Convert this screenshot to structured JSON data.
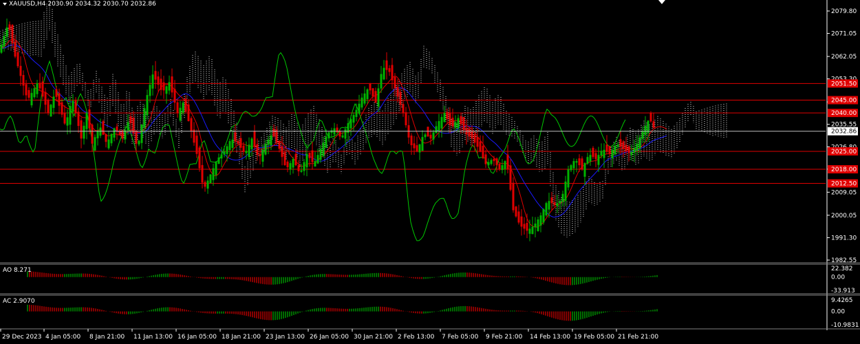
{
  "header": {
    "symbol_line": "XAUUSD,H4  2030.90 2034.32 2030.70 2032.86"
  },
  "colors": {
    "bull": "#00b400",
    "bear": "#e00000",
    "level_line": "#e00000",
    "ma_blue": "#1a1aff",
    "ma_red": "#e00000",
    "chikou": "#00c800",
    "cloud": "#ffffff",
    "axis": "#ffffff"
  },
  "price_axis": {
    "ticks": [
      "2079.80",
      "2071.05",
      "2062.05",
      "2053.30",
      "2044.30",
      "2035.55",
      "2026.80",
      "2018.05",
      "2009.05",
      "2000.05",
      "1991.30",
      "1982.55"
    ],
    "tick_values": [
      2079.8,
      2071.05,
      2062.05,
      2053.3,
      2044.3,
      2035.55,
      2026.8,
      2018.05,
      2009.05,
      2000.05,
      1991.3,
      1982.55
    ],
    "current_price": "2032.86",
    "current_value": 2032.86
  },
  "levels": [
    {
      "label": "2051.50",
      "value": 2051.5
    },
    {
      "label": "2045.00",
      "value": 2045.0
    },
    {
      "label": "2040.00",
      "value": 2040.0
    },
    {
      "label": "2025.00",
      "value": 2025.0
    },
    {
      "label": "2018.00",
      "value": 2018.0
    },
    {
      "label": "2012.50",
      "value": 2012.5
    }
  ],
  "time_axis": [
    "29 Dec 2023",
    "4 Jan 05:00",
    "8 Jan 21:00",
    "11 Jan 13:00",
    "16 Jan 05:00",
    "18 Jan 21:00",
    "23 Jan 13:00",
    "26 Jan 05:00",
    "30 Jan 21:00",
    "2 Feb 13:00",
    "7 Feb 05:00",
    "9 Feb 21:00",
    "14 Feb 13:00",
    "19 Feb 05:00",
    "21 Feb 21:00"
  ],
  "ao": {
    "label": "AO 8.271",
    "ticks": [
      "22.382",
      "0.00",
      "-33.913"
    ],
    "tick_values": [
      22.382,
      0,
      -33.913
    ]
  },
  "ac": {
    "label": "AC 2.9070",
    "ticks": [
      "9.4265",
      "0.00",
      "-10.9831"
    ],
    "tick_values": [
      9.4265,
      0,
      -10.9831
    ]
  },
  "chart_data": {
    "type": "candlestick",
    "symbol": "XAUUSD",
    "timeframe": "H4",
    "last_ohlc": {
      "open": 2030.9,
      "high": 2034.32,
      "low": 2030.7,
      "close": 2032.86
    },
    "y_range": [
      1982.55,
      2083.0
    ],
    "close_path": [
      [
        0,
        2065
      ],
      [
        12,
        2075
      ],
      [
        22,
        2062
      ],
      [
        40,
        2045
      ],
      [
        55,
        2052
      ],
      [
        70,
        2040
      ],
      [
        80,
        2048
      ],
      [
        95,
        2035
      ],
      [
        105,
        2046
      ],
      [
        118,
        2030
      ],
      [
        126,
        2040
      ],
      [
        134,
        2028
      ],
      [
        145,
        2035
      ],
      [
        155,
        2028
      ],
      [
        166,
        2034
      ],
      [
        178,
        2030
      ],
      [
        188,
        2038
      ],
      [
        200,
        2026
      ],
      [
        212,
        2045
      ],
      [
        222,
        2055
      ],
      [
        236,
        2048
      ],
      [
        246,
        2052
      ],
      [
        258,
        2040
      ],
      [
        266,
        2044
      ],
      [
        276,
        2035
      ],
      [
        286,
        2024
      ],
      [
        296,
        2010
      ],
      [
        306,
        2016
      ],
      [
        316,
        2022
      ],
      [
        326,
        2025
      ],
      [
        336,
        2030
      ],
      [
        346,
        2028
      ],
      [
        356,
        2024
      ],
      [
        366,
        2030
      ],
      [
        376,
        2022
      ],
      [
        386,
        2028
      ],
      [
        396,
        2032
      ],
      [
        406,
        2026
      ],
      [
        416,
        2018
      ],
      [
        426,
        2022
      ],
      [
        436,
        2016
      ],
      [
        446,
        2024
      ],
      [
        456,
        2020
      ],
      [
        466,
        2026
      ],
      [
        476,
        2032
      ],
      [
        486,
        2034
      ],
      [
        496,
        2030
      ],
      [
        506,
        2036
      ],
      [
        516,
        2040
      ],
      [
        526,
        2046
      ],
      [
        536,
        2050
      ],
      [
        546,
        2044
      ],
      [
        556,
        2058
      ],
      [
        566,
        2056
      ],
      [
        576,
        2048
      ],
      [
        586,
        2040
      ],
      [
        596,
        2028
      ],
      [
        606,
        2025
      ],
      [
        616,
        2032
      ],
      [
        626,
        2030
      ],
      [
        636,
        2036
      ],
      [
        646,
        2040
      ],
      [
        656,
        2034
      ],
      [
        666,
        2038
      ],
      [
        676,
        2032
      ],
      [
        686,
        2030
      ],
      [
        696,
        2026
      ],
      [
        706,
        2020
      ],
      [
        716,
        2022
      ],
      [
        726,
        2018
      ],
      [
        736,
        2022
      ],
      [
        746,
        2002
      ],
      [
        756,
        1996
      ],
      [
        766,
        1994
      ],
      [
        776,
        1996
      ],
      [
        786,
        2000
      ],
      [
        796,
        2006
      ],
      [
        806,
        2004
      ],
      [
        816,
        2006
      ],
      [
        826,
        2018
      ],
      [
        836,
        2022
      ],
      [
        846,
        2018
      ],
      [
        856,
        2024
      ],
      [
        866,
        2022
      ],
      [
        876,
        2026
      ],
      [
        886,
        2024
      ],
      [
        896,
        2028
      ],
      [
        906,
        2026
      ],
      [
        916,
        2024
      ],
      [
        926,
        2028
      ],
      [
        936,
        2034
      ],
      [
        944,
        2038
      ],
      [
        952,
        2032.86
      ]
    ]
  }
}
